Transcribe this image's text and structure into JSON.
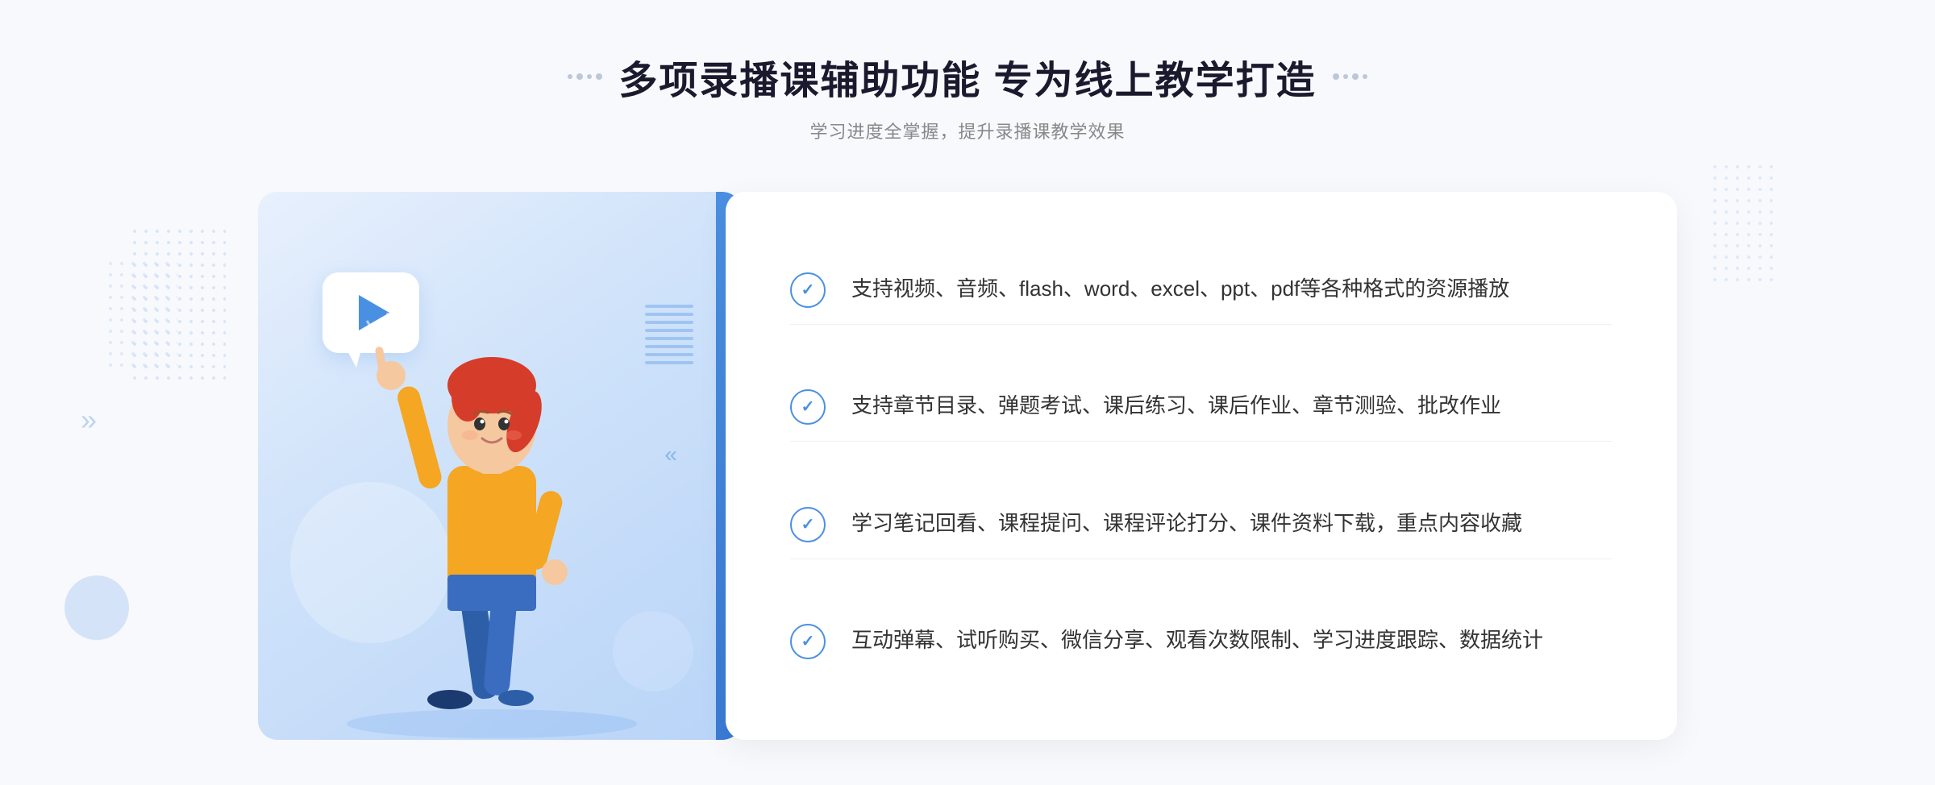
{
  "page": {
    "background": "#f7f9fc"
  },
  "header": {
    "title": "多项录播课辅助功能 专为线上教学打造",
    "subtitle": "学习进度全掌握，提升录播课教学效果",
    "title_prefix_dots": "decorative",
    "title_suffix_dots": "decorative"
  },
  "features": [
    {
      "id": 1,
      "text": "支持视频、音频、flash、word、excel、ppt、pdf等各种格式的资源播放"
    },
    {
      "id": 2,
      "text": "支持章节目录、弹题考试、课后练习、课后作业、章节测验、批改作业"
    },
    {
      "id": 3,
      "text": "学习笔记回看、课程提问、课程评论打分、课件资料下载，重点内容收藏"
    },
    {
      "id": 4,
      "text": "互动弹幕、试听购买、微信分享、观看次数限制、学习进度跟踪、数据统计"
    }
  ],
  "illustration": {
    "play_button_alt": "播放按钮",
    "figure_alt": "教学人物插图"
  },
  "decorative": {
    "chevron_symbol": "»",
    "chevron_left_symbol": "«"
  }
}
